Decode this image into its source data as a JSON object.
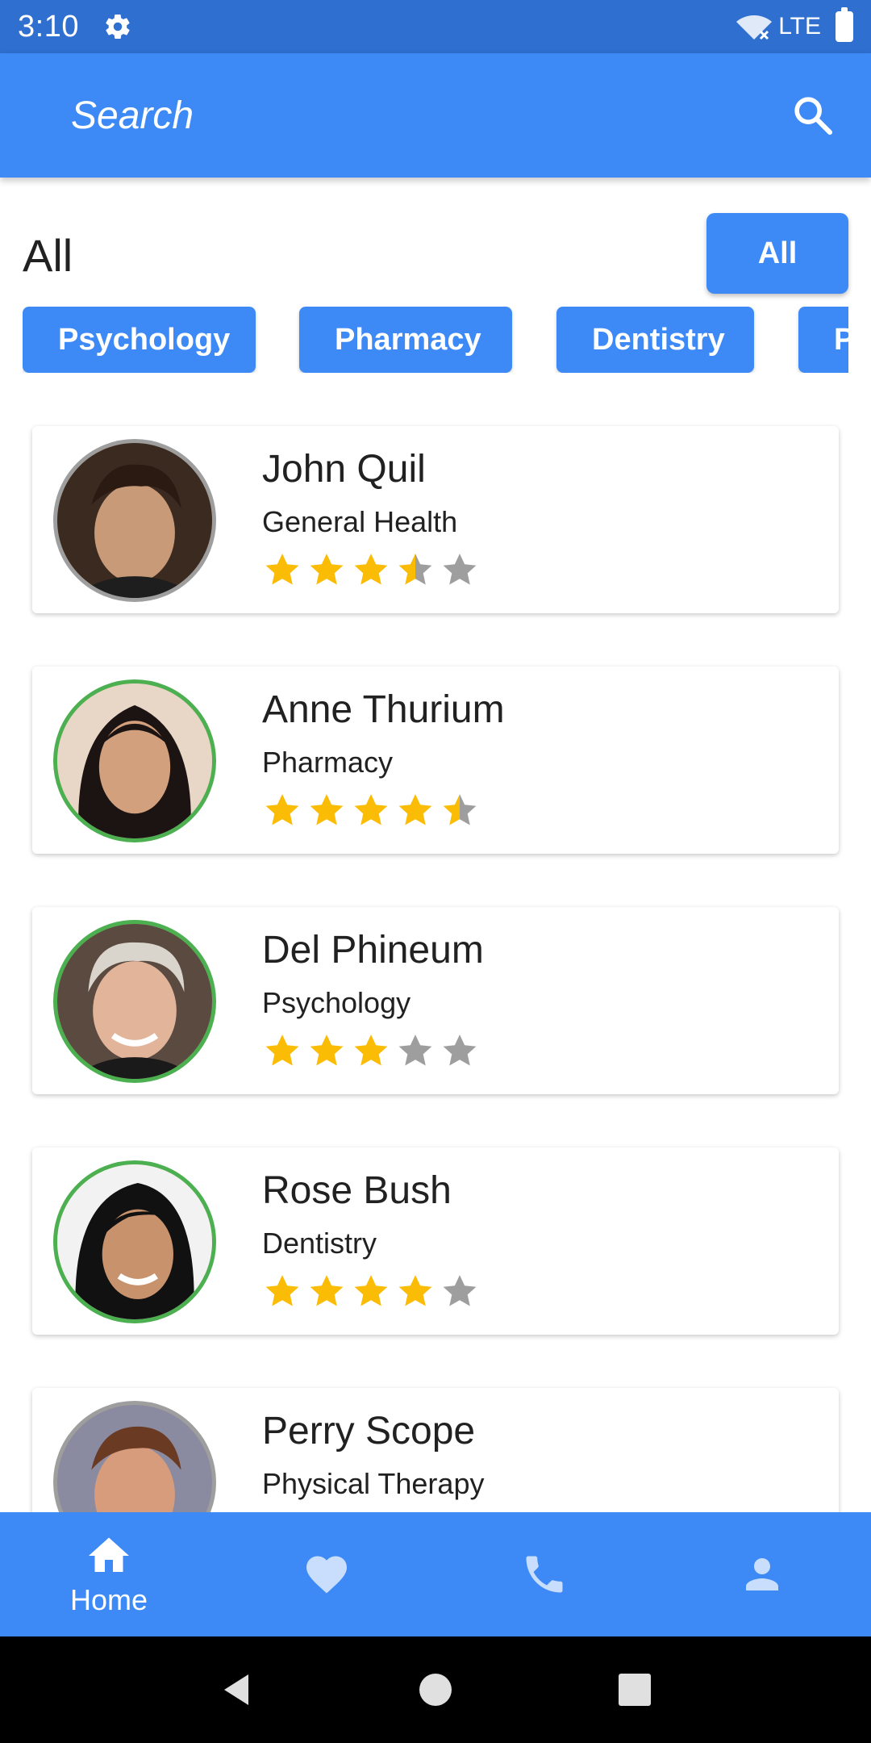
{
  "status_bar": {
    "time": "3:10",
    "network": "LTE"
  },
  "search": {
    "placeholder": "Search"
  },
  "filter": {
    "title": "All",
    "all_button": "All",
    "chips": [
      "Psychology",
      "Pharmacy",
      "Dentistry",
      "Physical Therapy"
    ]
  },
  "doctors": [
    {
      "name": "John Quil",
      "specialty": "General Health",
      "rating": 3.5,
      "online": false
    },
    {
      "name": "Anne Thurium",
      "specialty": "Pharmacy",
      "rating": 4.5,
      "online": true
    },
    {
      "name": "Del Phineum",
      "specialty": "Psychology",
      "rating": 3,
      "online": true
    },
    {
      "name": "Rose Bush",
      "specialty": "Dentistry",
      "rating": 4,
      "online": true
    },
    {
      "name": "Perry Scope",
      "specialty": "Physical Therapy",
      "rating": null,
      "online": false
    }
  ],
  "bottom_nav": {
    "items": [
      {
        "icon": "home-icon",
        "label": "Home"
      },
      {
        "icon": "heart-icon",
        "label": ""
      },
      {
        "icon": "phone-icon",
        "label": ""
      },
      {
        "icon": "person-icon",
        "label": ""
      }
    ]
  },
  "colors": {
    "primary": "#3d8af7",
    "status_bar": "#2f6fd0",
    "star_filled": "#fbbc05",
    "star_empty": "#9e9e9e",
    "online_ring": "#4caf50",
    "offline_ring": "#9e9e9e"
  }
}
